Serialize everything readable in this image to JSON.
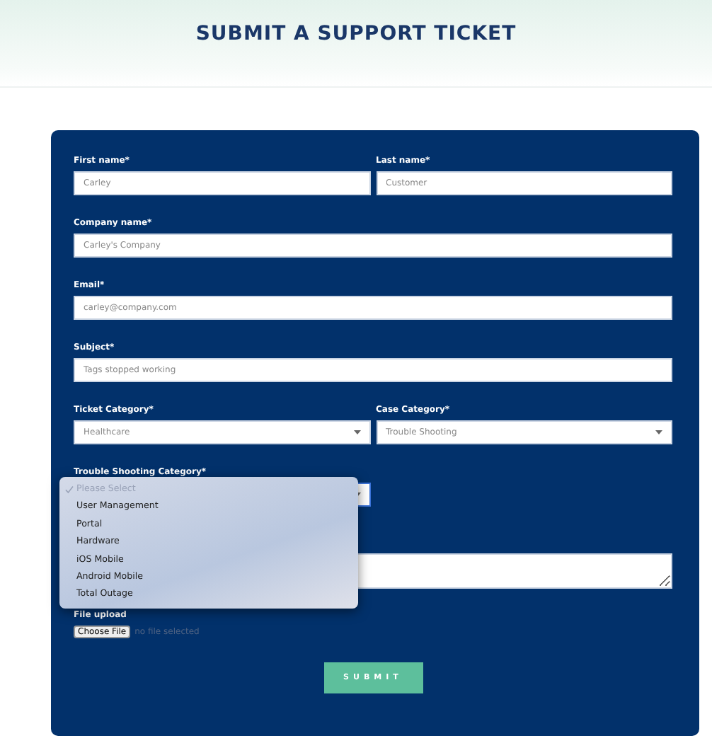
{
  "title": "SUBMIT A SUPPORT TICKET",
  "rows": [
    [
      {
        "kind": "input",
        "label": "First name*",
        "placeholder": "Carley"
      },
      {
        "kind": "input",
        "label": "Last name*",
        "placeholder": "Customer"
      }
    ],
    [
      {
        "kind": "input",
        "label": "Company name*",
        "placeholder": "Carley's Company"
      }
    ],
    [
      {
        "kind": "input",
        "label": "Email*",
        "placeholder": "carley@company.com"
      }
    ],
    [
      {
        "kind": "input",
        "label": "Subject*",
        "placeholder": "Tags stopped working"
      }
    ],
    [
      {
        "kind": "select",
        "label": "Ticket Category*",
        "value": "Healthcare"
      },
      {
        "kind": "select",
        "label": "Case Category*",
        "value": "Trouble Shooting"
      }
    ],
    [
      {
        "kind": "select",
        "label": "Trouble Shooting Category*",
        "open": true
      }
    ]
  ],
  "dropdown": [
    {
      "label": "Please Select",
      "selected": true,
      "disabled": true
    },
    {
      "label": "User Management",
      "selected": false,
      "disabled": false
    },
    {
      "label": "Portal",
      "selected": false,
      "disabled": false
    },
    {
      "label": "Hardware",
      "selected": false,
      "disabled": false
    },
    {
      "label": "iOS Mobile",
      "selected": false,
      "disabled": false
    },
    {
      "label": "Android Mobile",
      "selected": false,
      "disabled": false
    },
    {
      "label": "Total Outage",
      "selected": false,
      "disabled": false
    }
  ],
  "file_upload": {
    "label": "File upload",
    "button": "Choose File",
    "status": "no file selected"
  },
  "submit": "SUBMIT"
}
